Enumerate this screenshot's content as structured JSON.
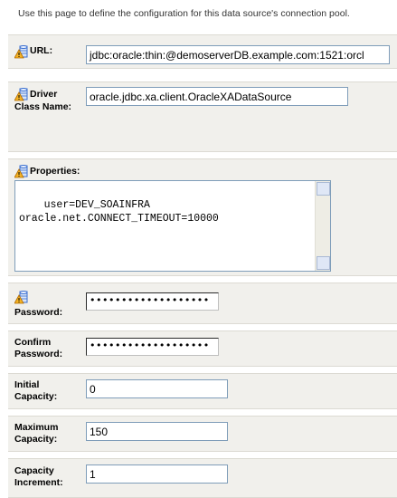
{
  "intro_text": "Use this page to define the configuration for this data source's connection pool.",
  "fields": {
    "url": {
      "label": "URL:",
      "value": "jdbc:oracle:thin:@demoserverDB.example.com:1521:orcl"
    },
    "driver": {
      "label_line1": "Driver",
      "label_line2": "Class Name:",
      "value": "oracle.jdbc.xa.client.OracleXADataSource"
    },
    "properties": {
      "label": "Properties:",
      "value": "user=DEV_SOAINFRA\noracle.net.CONNECT_TIMEOUT=10000"
    },
    "password": {
      "label": "Password:",
      "value": "•••••••••••••••••••"
    },
    "confirm_password": {
      "label_line1": "Confirm",
      "label_line2": "Password:",
      "value": "•••••••••••••••••••"
    },
    "initial_capacity": {
      "label_line1": "Initial",
      "label_line2": "Capacity:",
      "value": "0"
    },
    "maximum_capacity": {
      "label_line1": "Maximum",
      "label_line2": "Capacity:",
      "value": "150"
    },
    "capacity_increment": {
      "label_line1": "Capacity",
      "label_line2": "Increment:",
      "value": "1"
    }
  },
  "icons": {
    "required_field": "warning-db-icon"
  },
  "colors": {
    "section_bg": "#f1f0ec",
    "input_border": "#7f9db9",
    "icon_orange": "#f0a020",
    "icon_blue": "#3a6ed0"
  }
}
